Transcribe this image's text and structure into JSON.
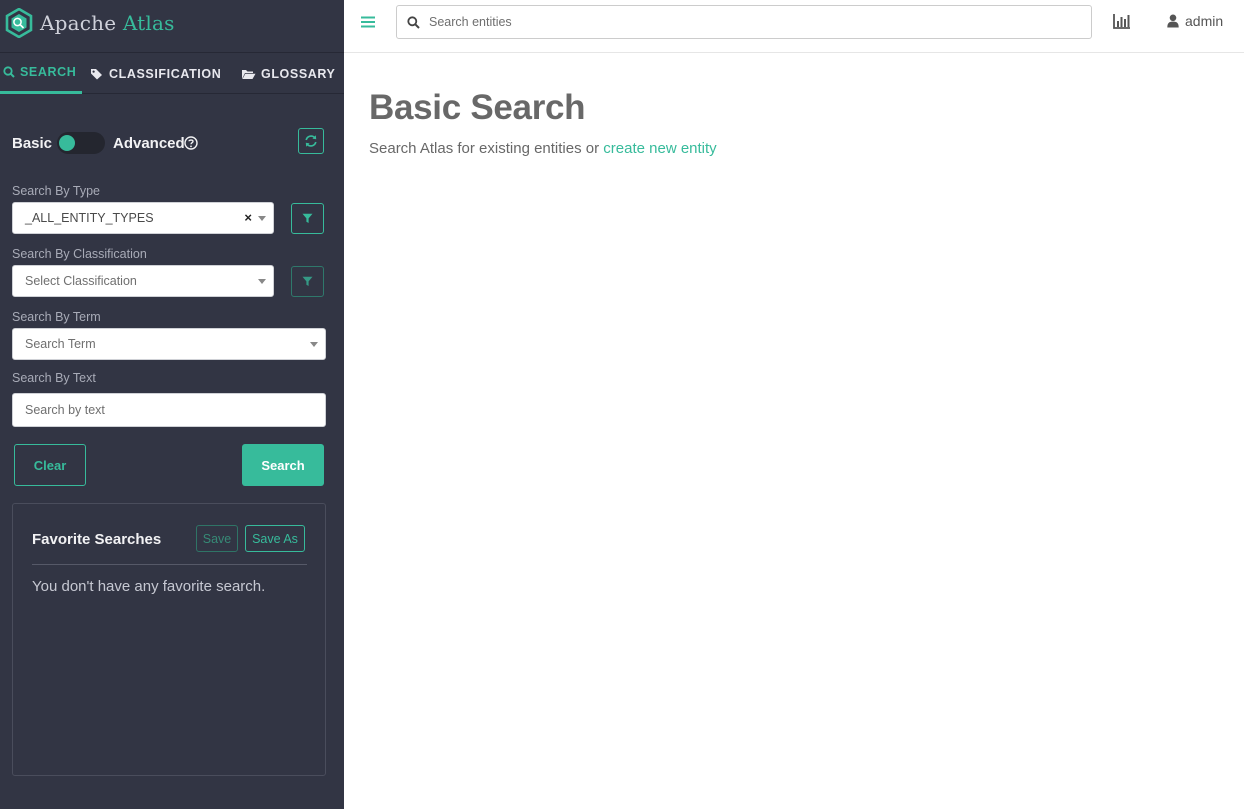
{
  "brand": {
    "name_part1": "Apache",
    "name_part2": "Atlas"
  },
  "tabs": [
    {
      "label": "SEARCH",
      "icon": "search-icon",
      "active": true
    },
    {
      "label": "CLASSIFICATION",
      "icon": "tag-icon",
      "active": false
    },
    {
      "label": "GLOSSARY",
      "icon": "folder-open-icon",
      "active": false
    }
  ],
  "search_mode": {
    "basic_label": "Basic",
    "advanced_label": "Advanced",
    "advanced_enabled": false
  },
  "filters": {
    "type": {
      "label": "Search By Type",
      "value": "_ALL_ENTITY_TYPES"
    },
    "classification": {
      "label": "Search By Classification",
      "placeholder": "Select Classification"
    },
    "term": {
      "label": "Search By Term",
      "placeholder": "Search Term"
    },
    "text": {
      "label": "Search By Text",
      "placeholder": "Search by text"
    }
  },
  "actions": {
    "clear_label": "Clear",
    "search_label": "Search"
  },
  "favorites": {
    "title": "Favorite Searches",
    "save_label": "Save",
    "save_as_label": "Save As",
    "empty_message": "You don't have any favorite search."
  },
  "header": {
    "search_placeholder": "Search entities",
    "user_name": "admin"
  },
  "main": {
    "title": "Basic Search",
    "subtitle_prefix": "Search Atlas for existing entities or ",
    "subtitle_link": "create new entity"
  },
  "colors": {
    "accent": "#37bb9b",
    "sidebar_bg": "#323544",
    "text": "#686868"
  }
}
